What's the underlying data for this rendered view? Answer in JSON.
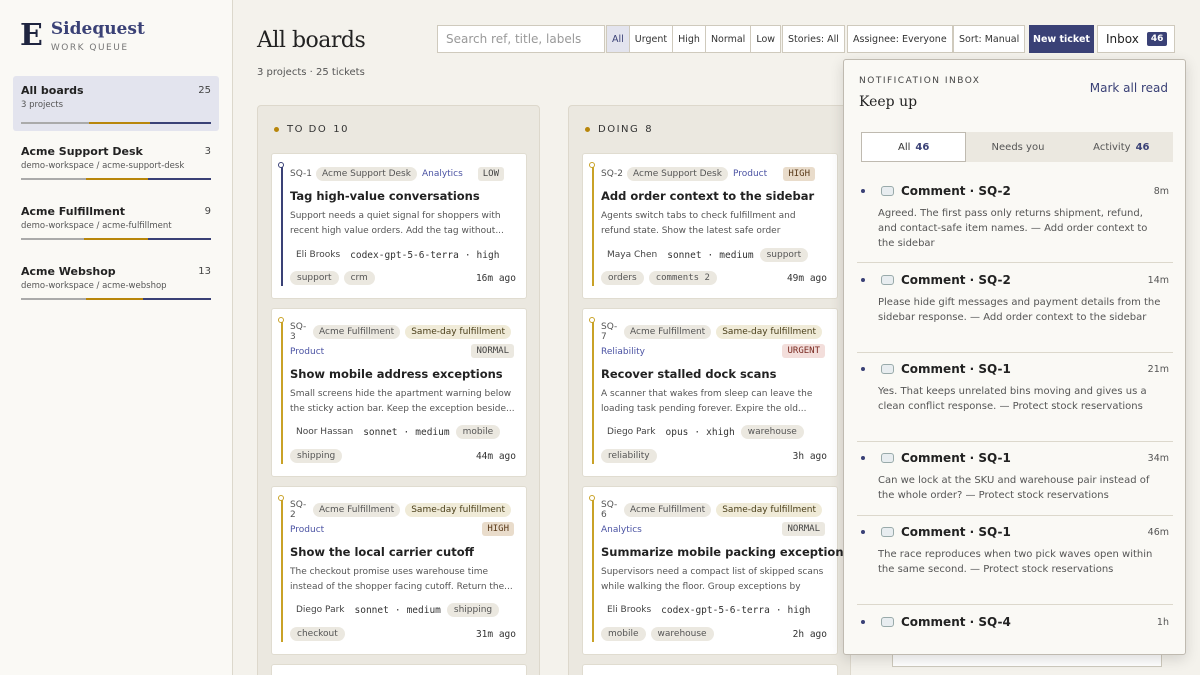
{
  "brand": {
    "logo": "E",
    "name": "Sidequest",
    "subtitle": "WORK QUEUE"
  },
  "sidebar": {
    "boards": [
      {
        "title": "All boards",
        "subtitle": "3 projects",
        "count": "25"
      },
      {
        "title": "Acme Support Desk",
        "subtitle": "demo-workspace / acme-support-desk",
        "count": "3"
      },
      {
        "title": "Acme Fulfillment",
        "subtitle": "demo-workspace / acme-fulfillment",
        "count": "9"
      },
      {
        "title": "Acme Webshop",
        "subtitle": "demo-workspace / acme-webshop",
        "count": "13"
      }
    ]
  },
  "header": {
    "title": "All boards",
    "subtitle": "3 projects · 25 tickets",
    "search_placeholder": "Search ref, title, labels",
    "priority_filters": [
      "All",
      "Urgent",
      "High",
      "Normal",
      "Low"
    ],
    "stories": "Stories: All",
    "assignee": "Assignee: Everyone",
    "sort": "Sort: Manual",
    "new_ticket": "New ticket",
    "inbox_label": "Inbox",
    "inbox_count": "46"
  },
  "columns": [
    {
      "name": "TO DO",
      "count": "10",
      "cards": [
        {
          "ref": "SQ-1",
          "project": "Acme Support Desk",
          "story": "",
          "category": "Analytics",
          "priority": "LOW",
          "title": "Tag high-value conversations",
          "desc": "Support needs a quiet signal for shoppers with recent high value orders. Add the tag without...",
          "assignee": "Eli Brooks",
          "model": "codex-gpt-5-6-terra",
          "effort": "high",
          "tags": [
            "support",
            "crm"
          ],
          "ago": "16m ago",
          "rail": "#3a4176"
        },
        {
          "ref": "SQ-3",
          "project": "Acme Fulfillment",
          "story": "Same-day fulfillment",
          "category": "Product",
          "priority": "NORMAL",
          "title": "Show mobile address exceptions",
          "desc": "Small screens hide the apartment warning below the sticky action bar. Keep the exception beside...",
          "assignee": "Noor Hassan",
          "model": "sonnet",
          "effort": "medium",
          "tags": [
            "mobile",
            "shipping"
          ],
          "ago": "44m ago",
          "rail": "#c9a227"
        },
        {
          "ref": "SQ-2",
          "project": "Acme Fulfillment",
          "story": "Same-day fulfillment",
          "category": "Product",
          "priority": "HIGH",
          "title": "Show the local carrier cutoff",
          "desc": "The checkout promise uses warehouse time instead of the shopper facing cutoff. Return the...",
          "assignee": "Diego Park",
          "model": "sonnet",
          "effort": "medium",
          "tags": [
            "shipping",
            "checkout"
          ],
          "ago": "31m ago",
          "rail": "#c9a227"
        }
      ]
    },
    {
      "name": "DOING",
      "count": "8",
      "cards": [
        {
          "ref": "SQ-2",
          "project": "Acme Support Desk",
          "story": "",
          "category": "Product",
          "priority": "HIGH",
          "title": "Add order context to the sidebar",
          "desc": "Agents switch tabs to check fulfillment and refund state. Show the latest safe order summar...",
          "assignee": "Maya Chen",
          "model": "sonnet",
          "effort": "medium",
          "tags": [
            "support",
            "orders",
            "comments 2"
          ],
          "ago": "49m ago",
          "rail": "#c9a227"
        },
        {
          "ref": "SQ-7",
          "project": "Acme Fulfillment",
          "story": "Same-day fulfillment",
          "category": "Reliability",
          "priority": "URGENT",
          "title": "Recover stalled dock scans",
          "desc": "A scanner that wakes from sleep can leave the loading task pending forever. Expire the old...",
          "assignee": "Diego Park",
          "model": "opus",
          "effort": "xhigh",
          "tags": [
            "warehouse",
            "reliability"
          ],
          "ago": "3h ago",
          "rail": "#c9a227"
        },
        {
          "ref": "SQ-6",
          "project": "Acme Fulfillment",
          "story": "Same-day fulfillment",
          "category": "Analytics",
          "priority": "NORMAL",
          "title": "Summarize mobile packing exceptions",
          "desc": "Supervisors need a compact list of skipped scans while walking the floor. Group exceptions by wav...",
          "assignee": "Eli Brooks",
          "model": "codex-gpt-5-6-terra",
          "effort": "high",
          "tags": [
            "mobile",
            "warehouse"
          ],
          "ago": "2h ago",
          "rail": "#c9a227"
        }
      ]
    }
  ],
  "inbox": {
    "kicker": "NOTIFICATION INBOX",
    "title": "Keep up",
    "mark_all_read": "Mark all read",
    "tabs": [
      {
        "label": "All",
        "count": "46"
      },
      {
        "label": "Needs you",
        "count": ""
      },
      {
        "label": "Activity",
        "count": "46"
      }
    ],
    "items": [
      {
        "title": "Comment · SQ-2",
        "time": "8m",
        "body": "Agreed. The first pass only returns shipment, refund, and contact-safe item names. — Add order context to the sidebar"
      },
      {
        "title": "Comment · SQ-2",
        "time": "14m",
        "body": "Please hide gift messages and payment details from the sidebar response. — Add order context to the sidebar"
      },
      {
        "title": "Comment · SQ-1",
        "time": "21m",
        "body": "Yes. That keeps unrelated bins moving and gives us a clean conflict response. — Protect stock reservations"
      },
      {
        "title": "Comment · SQ-1",
        "time": "34m",
        "body": "Can we lock at the SKU and warehouse pair instead of the whole order? — Protect stock reservations"
      },
      {
        "title": "Comment · SQ-1",
        "time": "46m",
        "body": "The race reproduces when two pick waves open within the same second. — Protect stock reservations"
      },
      {
        "title": "Comment · SQ-4",
        "time": "1h",
        "body": ""
      }
    ]
  },
  "colors": {
    "accent": "#3a4176",
    "gold": "#b8860b"
  }
}
